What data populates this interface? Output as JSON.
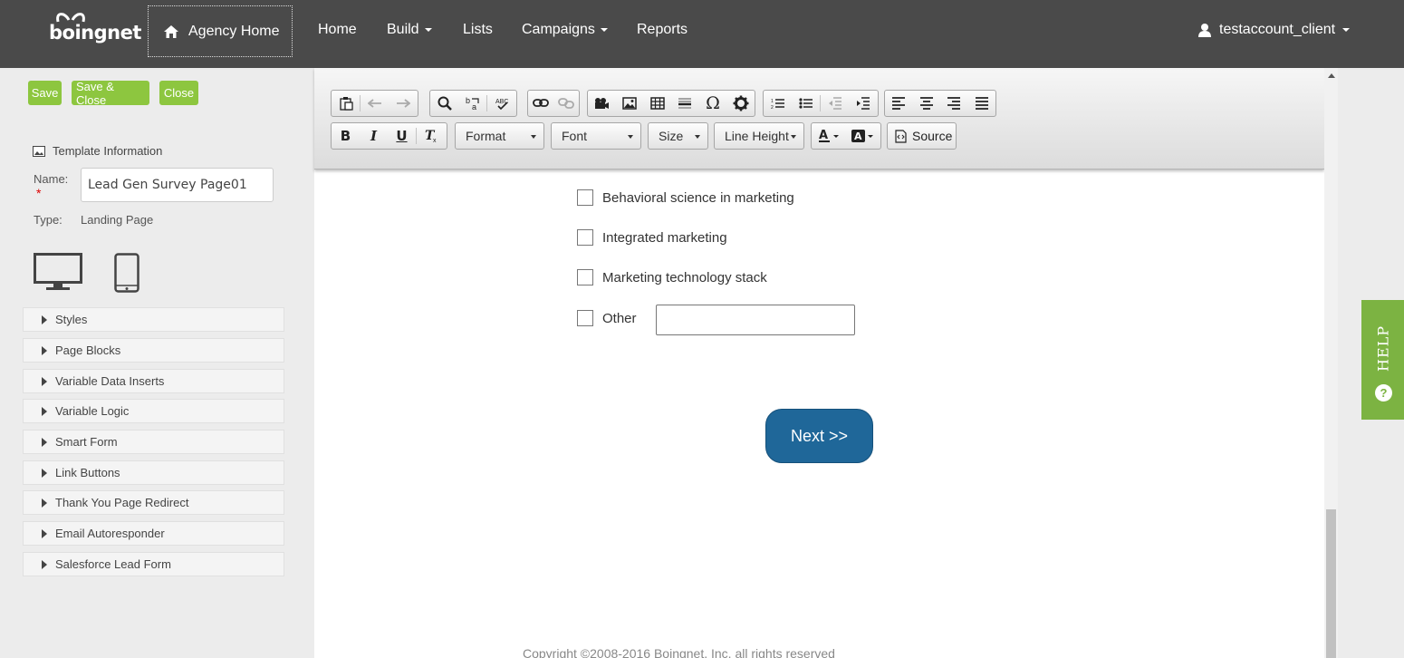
{
  "nav": {
    "logo": "boingnet",
    "agency_home": "Agency Home",
    "home": "Home",
    "build": "Build",
    "lists": "Lists",
    "campaigns": "Campaigns",
    "reports": "Reports",
    "user": "testaccount_client"
  },
  "actions": {
    "save": "Save",
    "save_close": "Save & Close",
    "close": "Close"
  },
  "template": {
    "info_label": "Template Information",
    "name_label": "Name:",
    "required_mark": "*",
    "name_value": "Lead Gen Survey Page01",
    "type_label": "Type:",
    "type_value": "Landing Page"
  },
  "sections": [
    "Styles",
    "Page Blocks",
    "Variable Data Inserts",
    "Variable Logic",
    "Smart Form",
    "Link Buttons",
    "Thank You Page Redirect",
    "Email Autoresponder",
    "Salesforce Lead Form"
  ],
  "editor": {
    "format": "Format",
    "font": "Font",
    "size": "Size",
    "line_height": "Line Height",
    "source": "Source"
  },
  "form": {
    "options": [
      "Behavioral science in marketing",
      "Integrated marketing",
      "Marketing technology stack",
      "Other"
    ],
    "other_value": "",
    "next": "Next >>"
  },
  "footer": {
    "copyright": "Copyright ©2008-2016 Boingnet, Inc. all rights reserved"
  },
  "help": {
    "label": "HELP"
  },
  "colors": {
    "nav_bg": "#4a4a4a",
    "action_green": "#8dc63f",
    "next_blue": "#1f6799",
    "help_green": "#7cb342"
  }
}
